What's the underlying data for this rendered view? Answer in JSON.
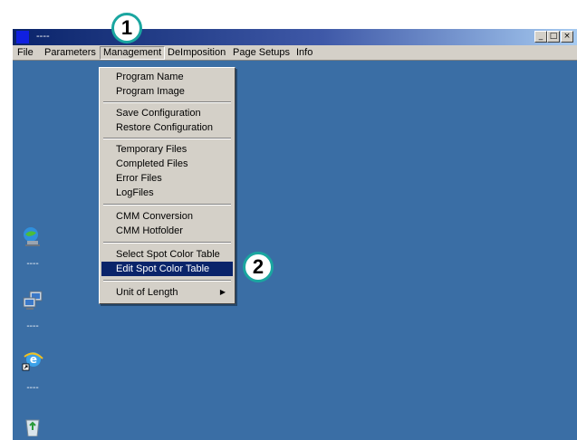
{
  "window": {
    "title": "----",
    "buttons": {
      "minimize": "_",
      "maximize": "□",
      "close": "×"
    }
  },
  "menubar": {
    "items": [
      "File",
      "Parameters",
      "Management",
      "DeImposition",
      "Page Setups",
      "Info"
    ]
  },
  "management_menu": {
    "groups": [
      [
        "Program Name",
        "Program Image"
      ],
      [
        "Save Configuration",
        "Restore Configuration"
      ],
      [
        "Temporary Files",
        "Completed Files",
        "Error Files",
        "LogFiles"
      ],
      [
        "CMM Conversion",
        "CMM Hotfolder"
      ],
      [
        "Select Spot Color Table",
        "Edit Spot Color Table"
      ],
      [
        "Unit of Length"
      ]
    ],
    "selected_item": "Edit Spot Color Table",
    "submenu_arrow": "▶"
  },
  "desktop_icons": [
    {
      "icon": "computer-icon",
      "label": "----"
    },
    {
      "icon": "network-icon",
      "label": "----"
    },
    {
      "icon": "internet-explorer-icon",
      "label": "----"
    },
    {
      "icon": "recycle-bin-icon",
      "label": ""
    }
  ],
  "callouts": {
    "one": "1",
    "two": "2"
  },
  "colors": {
    "desktop": "#3a6ea5",
    "titlebar_start": "#0a246a",
    "menu_bg": "#d4d0c8",
    "selection": "#0a246a",
    "callout_border": "#1aa6a0"
  }
}
